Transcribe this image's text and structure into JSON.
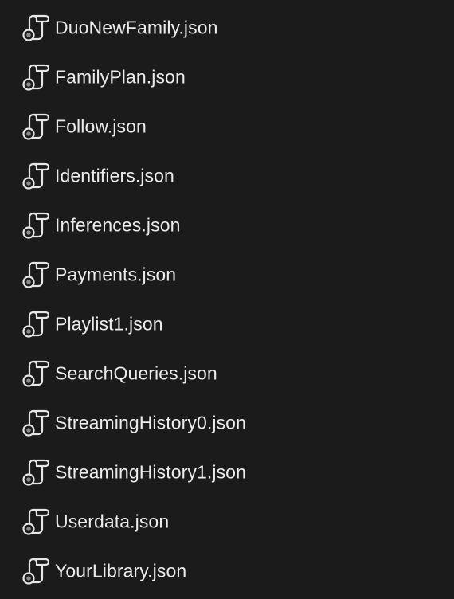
{
  "files": [
    {
      "name": "DuoNewFamily.json",
      "icon": "script-file-icon"
    },
    {
      "name": "FamilyPlan.json",
      "icon": "script-file-icon"
    },
    {
      "name": "Follow.json",
      "icon": "script-file-icon"
    },
    {
      "name": "Identifiers.json",
      "icon": "script-file-icon"
    },
    {
      "name": "Inferences.json",
      "icon": "script-file-icon"
    },
    {
      "name": "Payments.json",
      "icon": "script-file-icon"
    },
    {
      "name": "Playlist1.json",
      "icon": "script-file-icon"
    },
    {
      "name": "SearchQueries.json",
      "icon": "script-file-icon"
    },
    {
      "name": "StreamingHistory0.json",
      "icon": "script-file-icon"
    },
    {
      "name": "StreamingHistory1.json",
      "icon": "script-file-icon"
    },
    {
      "name": "Userdata.json",
      "icon": "script-file-icon"
    },
    {
      "name": "YourLibrary.json",
      "icon": "script-file-icon"
    }
  ],
  "colors": {
    "background": "#1b1b1b",
    "text": "#ececec",
    "icon_stroke": "#e6e6e6"
  }
}
